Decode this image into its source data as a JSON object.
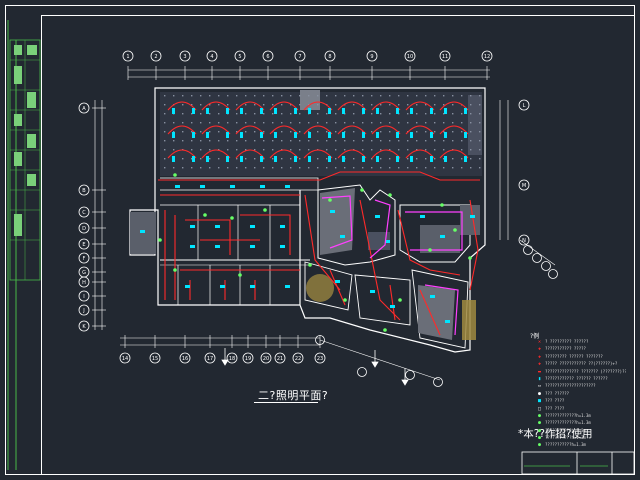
{
  "drawing": {
    "title": "二?照明平面?",
    "note": "*本??作招?使用",
    "legend_title": "?例",
    "legend": [
      {
        "symbol": "red-x",
        "label": "?  ?????????  ??????"
      },
      {
        "symbol": "red-cross",
        "label": "???????????  ?????"
      },
      {
        "symbol": "red-cross",
        "label": "?????????  ??????  ???????"
      },
      {
        "symbol": "red-cross",
        "label": "?????  ???????????  ??(??????)+?"
      },
      {
        "symbol": "red-dash",
        "label": "??????????????  ???????  (???????)?????"
      },
      {
        "symbol": "cyan-rect",
        "label": "????????????  ??????  ??????"
      },
      {
        "symbol": "white-box",
        "label": "?????????????????????"
      },
      {
        "symbol": "white-dot",
        "label": "???  ??????"
      },
      {
        "symbol": "cyan-sq",
        "label": "???  ????"
      },
      {
        "symbol": "white-sq",
        "label": "???  ????"
      },
      {
        "symbol": "green-dot",
        "label": "?????????????h=1.3m"
      },
      {
        "symbol": "green-dot",
        "label": "?????????????h=1.3m"
      },
      {
        "symbol": "green-dot",
        "label": "???????????h=1.3m"
      },
      {
        "symbol": "green-dot",
        "label": "???????????h=1.3m"
      },
      {
        "symbol": "green-dot",
        "label": "???????????h=1.3m"
      }
    ],
    "axis_top": [
      "1",
      "2",
      "3",
      "4",
      "5",
      "6",
      "7",
      "8",
      "9",
      "10",
      "11",
      "12"
    ],
    "axis_bottom": [
      "14",
      "15",
      "16",
      "17",
      "18",
      "19",
      "20",
      "21",
      "22",
      "23"
    ],
    "axis_left": [
      "A",
      "B",
      "C",
      "D",
      "E",
      "F",
      "G",
      "H",
      "I",
      "J",
      "K"
    ],
    "axis_right": [
      "L",
      "M",
      "N"
    ],
    "colors": {
      "background": "#222831",
      "border": "#ffffff",
      "frame": "#48b848",
      "wall": "#ffffff",
      "wiring": "#ff2a2a",
      "fixture": "#00e5ff",
      "accent": "#ff40ff",
      "device": "#66ff66"
    }
  }
}
